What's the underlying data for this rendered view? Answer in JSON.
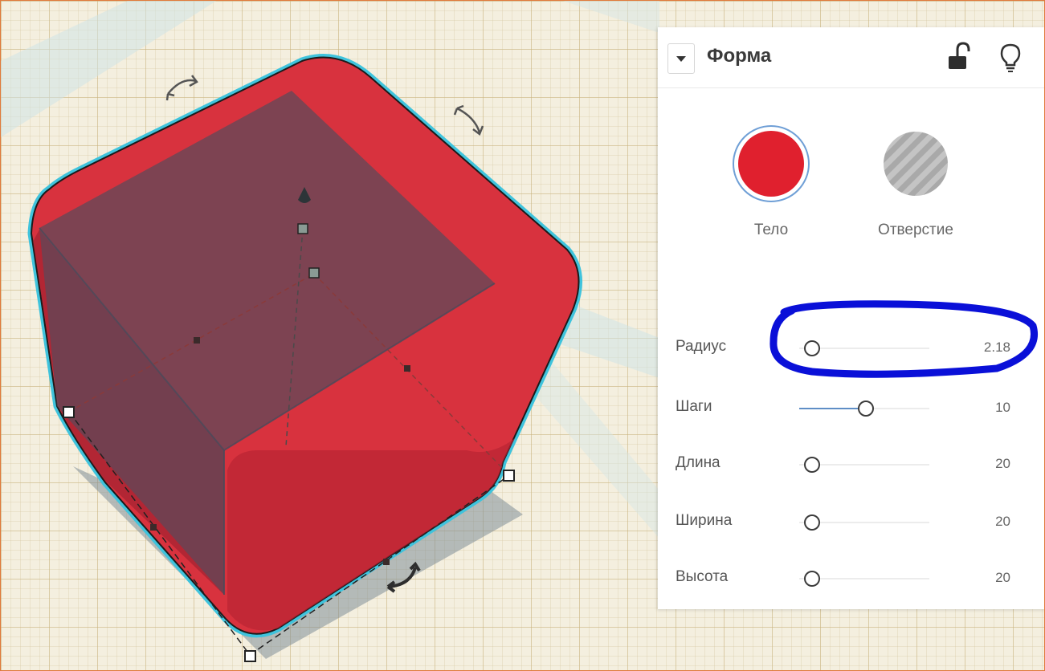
{
  "panel": {
    "title": "Форма",
    "collapse_icon": "chevron-down-icon",
    "lock_icon": "unlocked-icon",
    "bulb_icon": "lightbulb-icon",
    "solid_label": "Тело",
    "hole_label": "Отверстие",
    "solid_color": "#e0202e",
    "params": [
      {
        "label": "Радиус",
        "value": "2.18",
        "level": 0.0
      },
      {
        "label": "Шаги",
        "value": "10",
        "level": 0.45
      },
      {
        "label": "Длина",
        "value": "20",
        "level": 0.0
      },
      {
        "label": "Ширина",
        "value": "20",
        "level": 0.0
      },
      {
        "label": "Высота",
        "value": "20",
        "level": 0.0
      }
    ]
  },
  "colors": {
    "shape_red": "#d8323e",
    "selection_outline": "#3fc3dc",
    "annotation": "#0a10d8",
    "slider_fill": "#5f8ec6"
  }
}
